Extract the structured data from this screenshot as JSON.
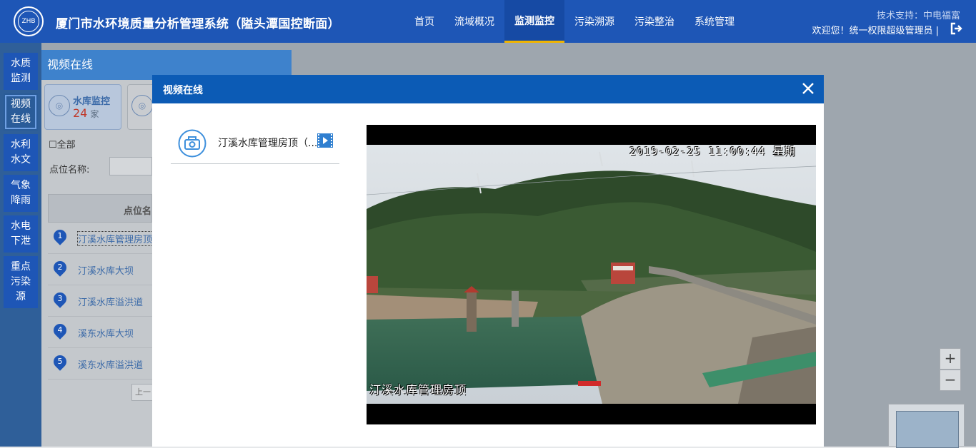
{
  "header": {
    "title": "厦门市水环境质量分析管理系统（隘头潭国控断面）",
    "logo_text": "ZHB",
    "nav": [
      "首页",
      "流域概况",
      "监测监控",
      "污染溯源",
      "污染整治",
      "系统管理"
    ],
    "active_nav": "监测监控",
    "tech_support": "技术支持：中电福富",
    "welcome": "欢迎您！统一权限超级管理员 |"
  },
  "sidebar": {
    "items": [
      {
        "label": "水质\n监测"
      },
      {
        "label": "视频\n在线"
      },
      {
        "label": "水利\n水文"
      },
      {
        "label": "气象\n降雨"
      },
      {
        "label": "水电\n下泄"
      },
      {
        "label": "重点\n污染\n源"
      }
    ]
  },
  "panel": {
    "title": "视频在线",
    "card": {
      "label": "水库监控",
      "count": "24",
      "unit": "家"
    },
    "select_all": "全部",
    "name_label": "点位名称:",
    "table_header": "点位名",
    "rows": [
      {
        "num": "1",
        "name": "汀溪水库管理房顶"
      },
      {
        "num": "2",
        "name": "汀溪水库大坝"
      },
      {
        "num": "3",
        "name": "汀溪水库溢洪道"
      },
      {
        "num": "4",
        "name": "溪东水库大坝"
      },
      {
        "num": "5",
        "name": "溪东水库溢洪道"
      }
    ],
    "pager": "上一"
  },
  "map_controls": {
    "zoom_in": "+",
    "zoom_out": "−"
  },
  "modal": {
    "title": "视频在线",
    "camera_label": "汀溪水库管理房顶（...",
    "video": {
      "timestamp": "2019-02-25 11:00:44 星期",
      "camera_name": "汀溪水库管理房顶"
    }
  },
  "colors": {
    "header": "#1e56b6",
    "modal_header": "#0c5bb5",
    "accent": "#f0b400"
  }
}
